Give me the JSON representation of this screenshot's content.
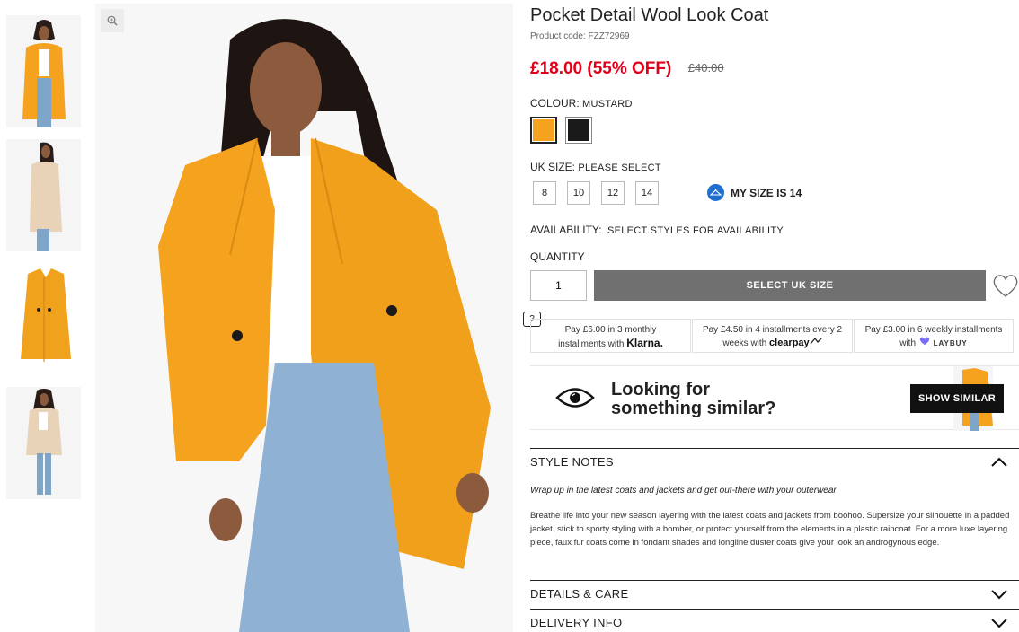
{
  "product": {
    "title": "Pocket Detail Wool Look Coat",
    "code": "Product code: FZZ72969",
    "price_now": "£18.00 (55% OFF)",
    "price_was": "£40.00"
  },
  "colour": {
    "label": "COLOUR:",
    "value": "MUSTARD",
    "options": [
      {
        "name": "Mustard",
        "hex": "#f5a31e"
      },
      {
        "name": "Black",
        "hex": "#1a1a1a"
      }
    ]
  },
  "size": {
    "label": "UK SIZE:",
    "value": "PLEASE SELECT",
    "options": [
      "8",
      "10",
      "12",
      "14"
    ],
    "my_size": "MY SIZE IS 14"
  },
  "availability": {
    "label": "AVAILABILITY:",
    "value": "SELECT STYLES FOR AVAILABILITY"
  },
  "quantity": {
    "label": "QUANTITY",
    "value": "1"
  },
  "cta": {
    "select_label": "SELECT UK SIZE",
    "help": "?"
  },
  "payments": [
    {
      "line1": "Pay £6.00 in 3 monthly",
      "line2": "installments with",
      "brand": "Klarna."
    },
    {
      "line1": "Pay £4.50 in 4 installments every 2",
      "line2": "weeks with",
      "brand": "clearpay"
    },
    {
      "line1": "Pay £3.00 in 6 weekly installments",
      "line2": "with",
      "brand": "LAYBUY"
    }
  ],
  "similar": {
    "line1": "Looking for",
    "line2": "something similar?",
    "button": "SHOW SIMILAR"
  },
  "style_notes": {
    "title": "STYLE NOTES",
    "tagline": "Wrap up in the latest coats and jackets and get out-there with your outerwear",
    "body": "Breathe life into your new season layering with the latest coats and jackets from boohoo. Supersize your silhouette in a padded jacket, stick to sporty styling with a bomber, or protect yourself from the elements in a plastic raincoat. For a more luxe layering piece, faux fur coats come in fondant shades and longline duster coats give your look an androgynous edge."
  },
  "accordions": {
    "details": "DETAILS & CARE",
    "delivery": "DELIVERY INFO"
  },
  "colors": {
    "mustard": "#f5a31e",
    "sale_red": "#e0001a",
    "button_grey": "#707070"
  }
}
